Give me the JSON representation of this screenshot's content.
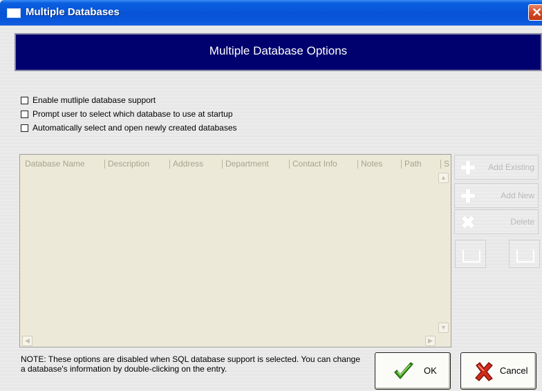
{
  "window": {
    "title": "Multiple Databases",
    "close_symbol": "✕"
  },
  "banner": {
    "title": "Multiple Database Options"
  },
  "options": [
    {
      "label": "Enable mutliple database support",
      "checked": false
    },
    {
      "label": "Prompt user to select which database to use at startup",
      "checked": false
    },
    {
      "label": "Automatically select and open newly created databases",
      "checked": false
    }
  ],
  "table": {
    "columns": [
      "Database Name",
      "Description",
      "Address",
      "Department",
      "Contact Info",
      "Notes",
      "Path",
      "S"
    ],
    "rows": []
  },
  "side_buttons": {
    "add_existing": "Add Existing",
    "add_new": "Add New",
    "delete": "Delete"
  },
  "note": "NOTE: These options are disabled when SQL database support is selected.  You can change a database's information by double-clicking on the entry.",
  "footer": {
    "ok": "OK",
    "cancel": "Cancel"
  }
}
